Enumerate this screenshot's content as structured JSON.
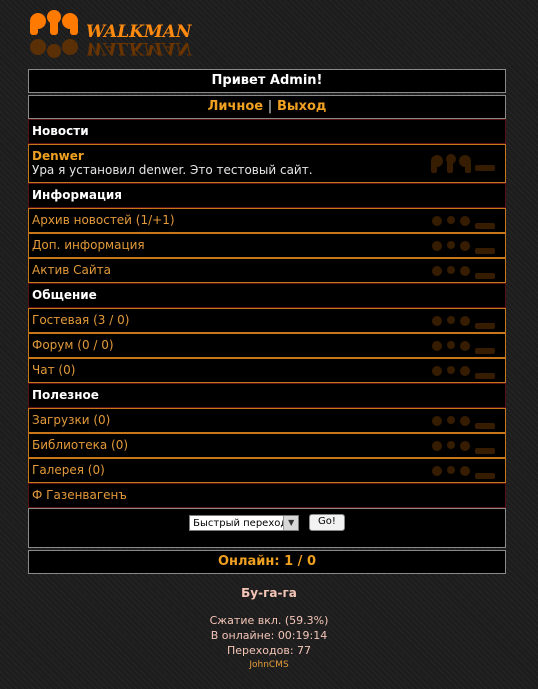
{
  "logo": {
    "text": "WALKMAN",
    "reflection": "WALKMAN"
  },
  "header": {
    "greeting": "Привет Admin!"
  },
  "nav": {
    "personal": "Личное",
    "sep": "|",
    "logout": "Выход"
  },
  "news": {
    "section": "Новости",
    "title": "Denwer",
    "body": "Ура я установил denwer. Это тестовый сайт."
  },
  "info": {
    "section": "Информация",
    "items": [
      "Архив новостей (1/+1)",
      "Доп. информация",
      "Актив Сайта"
    ]
  },
  "communication": {
    "section": "Общение",
    "items": [
      "Гостевая (3 / 0)",
      "Форум (0 / 0)",
      "Чат (0)"
    ]
  },
  "useful": {
    "section": "Полезное",
    "items": [
      "Загрузки (0)",
      "Библиотека (0)",
      "Галерея (0)"
    ]
  },
  "extra_link": "Ф Газенвагенъ",
  "quick": {
    "select_value": "Быстрый переход",
    "go_label": "Go!"
  },
  "online": "Онлайн: 1 / 0",
  "footer": {
    "title": "Бу-га-га",
    "compression": "Сжатие вкл. (59.3%)",
    "online_time": "В онлайне: 00:19:14",
    "transitions": "Переходов: 77",
    "engine": "JohnCMS"
  },
  "colors": {
    "accent": "#f0a020",
    "link": "#e39a3a",
    "item_border": "#c8761a",
    "section_border": "#5a1010"
  },
  "icons": {
    "watermark": "walkman-w-icon",
    "dropdown": "chevron-down-icon",
    "logo": "walkman-logo"
  }
}
